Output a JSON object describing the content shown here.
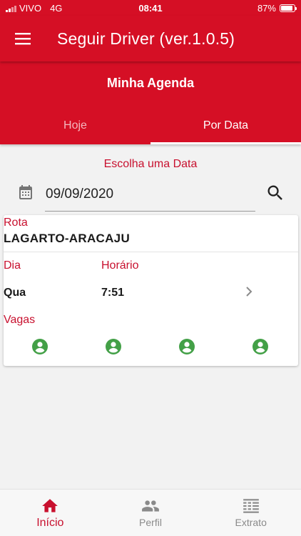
{
  "status_bar": {
    "carrier": "VIVO",
    "network": "4G",
    "time": "08:41",
    "battery": "87%",
    "battery_level": 0.87
  },
  "app_bar": {
    "title": "Seguir Driver (ver.1.0.5)",
    "menu_icon": "menu-icon"
  },
  "agenda": {
    "title": "Minha Agenda",
    "tabs": [
      {
        "label": "Hoje",
        "active": false
      },
      {
        "label": "Por Data",
        "active": true
      }
    ]
  },
  "date_picker": {
    "label": "Escolha uma Data",
    "value": "09/09/2020",
    "calendar_icon": "calendar-icon",
    "search_icon": "search-icon"
  },
  "trip_card": {
    "rota_label": "Rota",
    "rota_value": "LAGARTO-ARACAJU",
    "dia_label": "Dia",
    "dia_value": "Qua",
    "horario_label": "Horário",
    "horario_value": "7:51",
    "vagas_label": "Vagas",
    "vagas_count": 4,
    "seat_icon": "person-circle-icon"
  },
  "bottom_nav": [
    {
      "label": "Início",
      "icon": "home-icon",
      "active": true
    },
    {
      "label": "Perfil",
      "icon": "people-icon",
      "active": false
    },
    {
      "label": "Extrato",
      "icon": "statement-icon",
      "active": false
    }
  ],
  "colors": {
    "primary": "#d50f25",
    "accent_text": "#c8102e",
    "seat_green": "#43a047",
    "background": "#f2f2f2"
  }
}
